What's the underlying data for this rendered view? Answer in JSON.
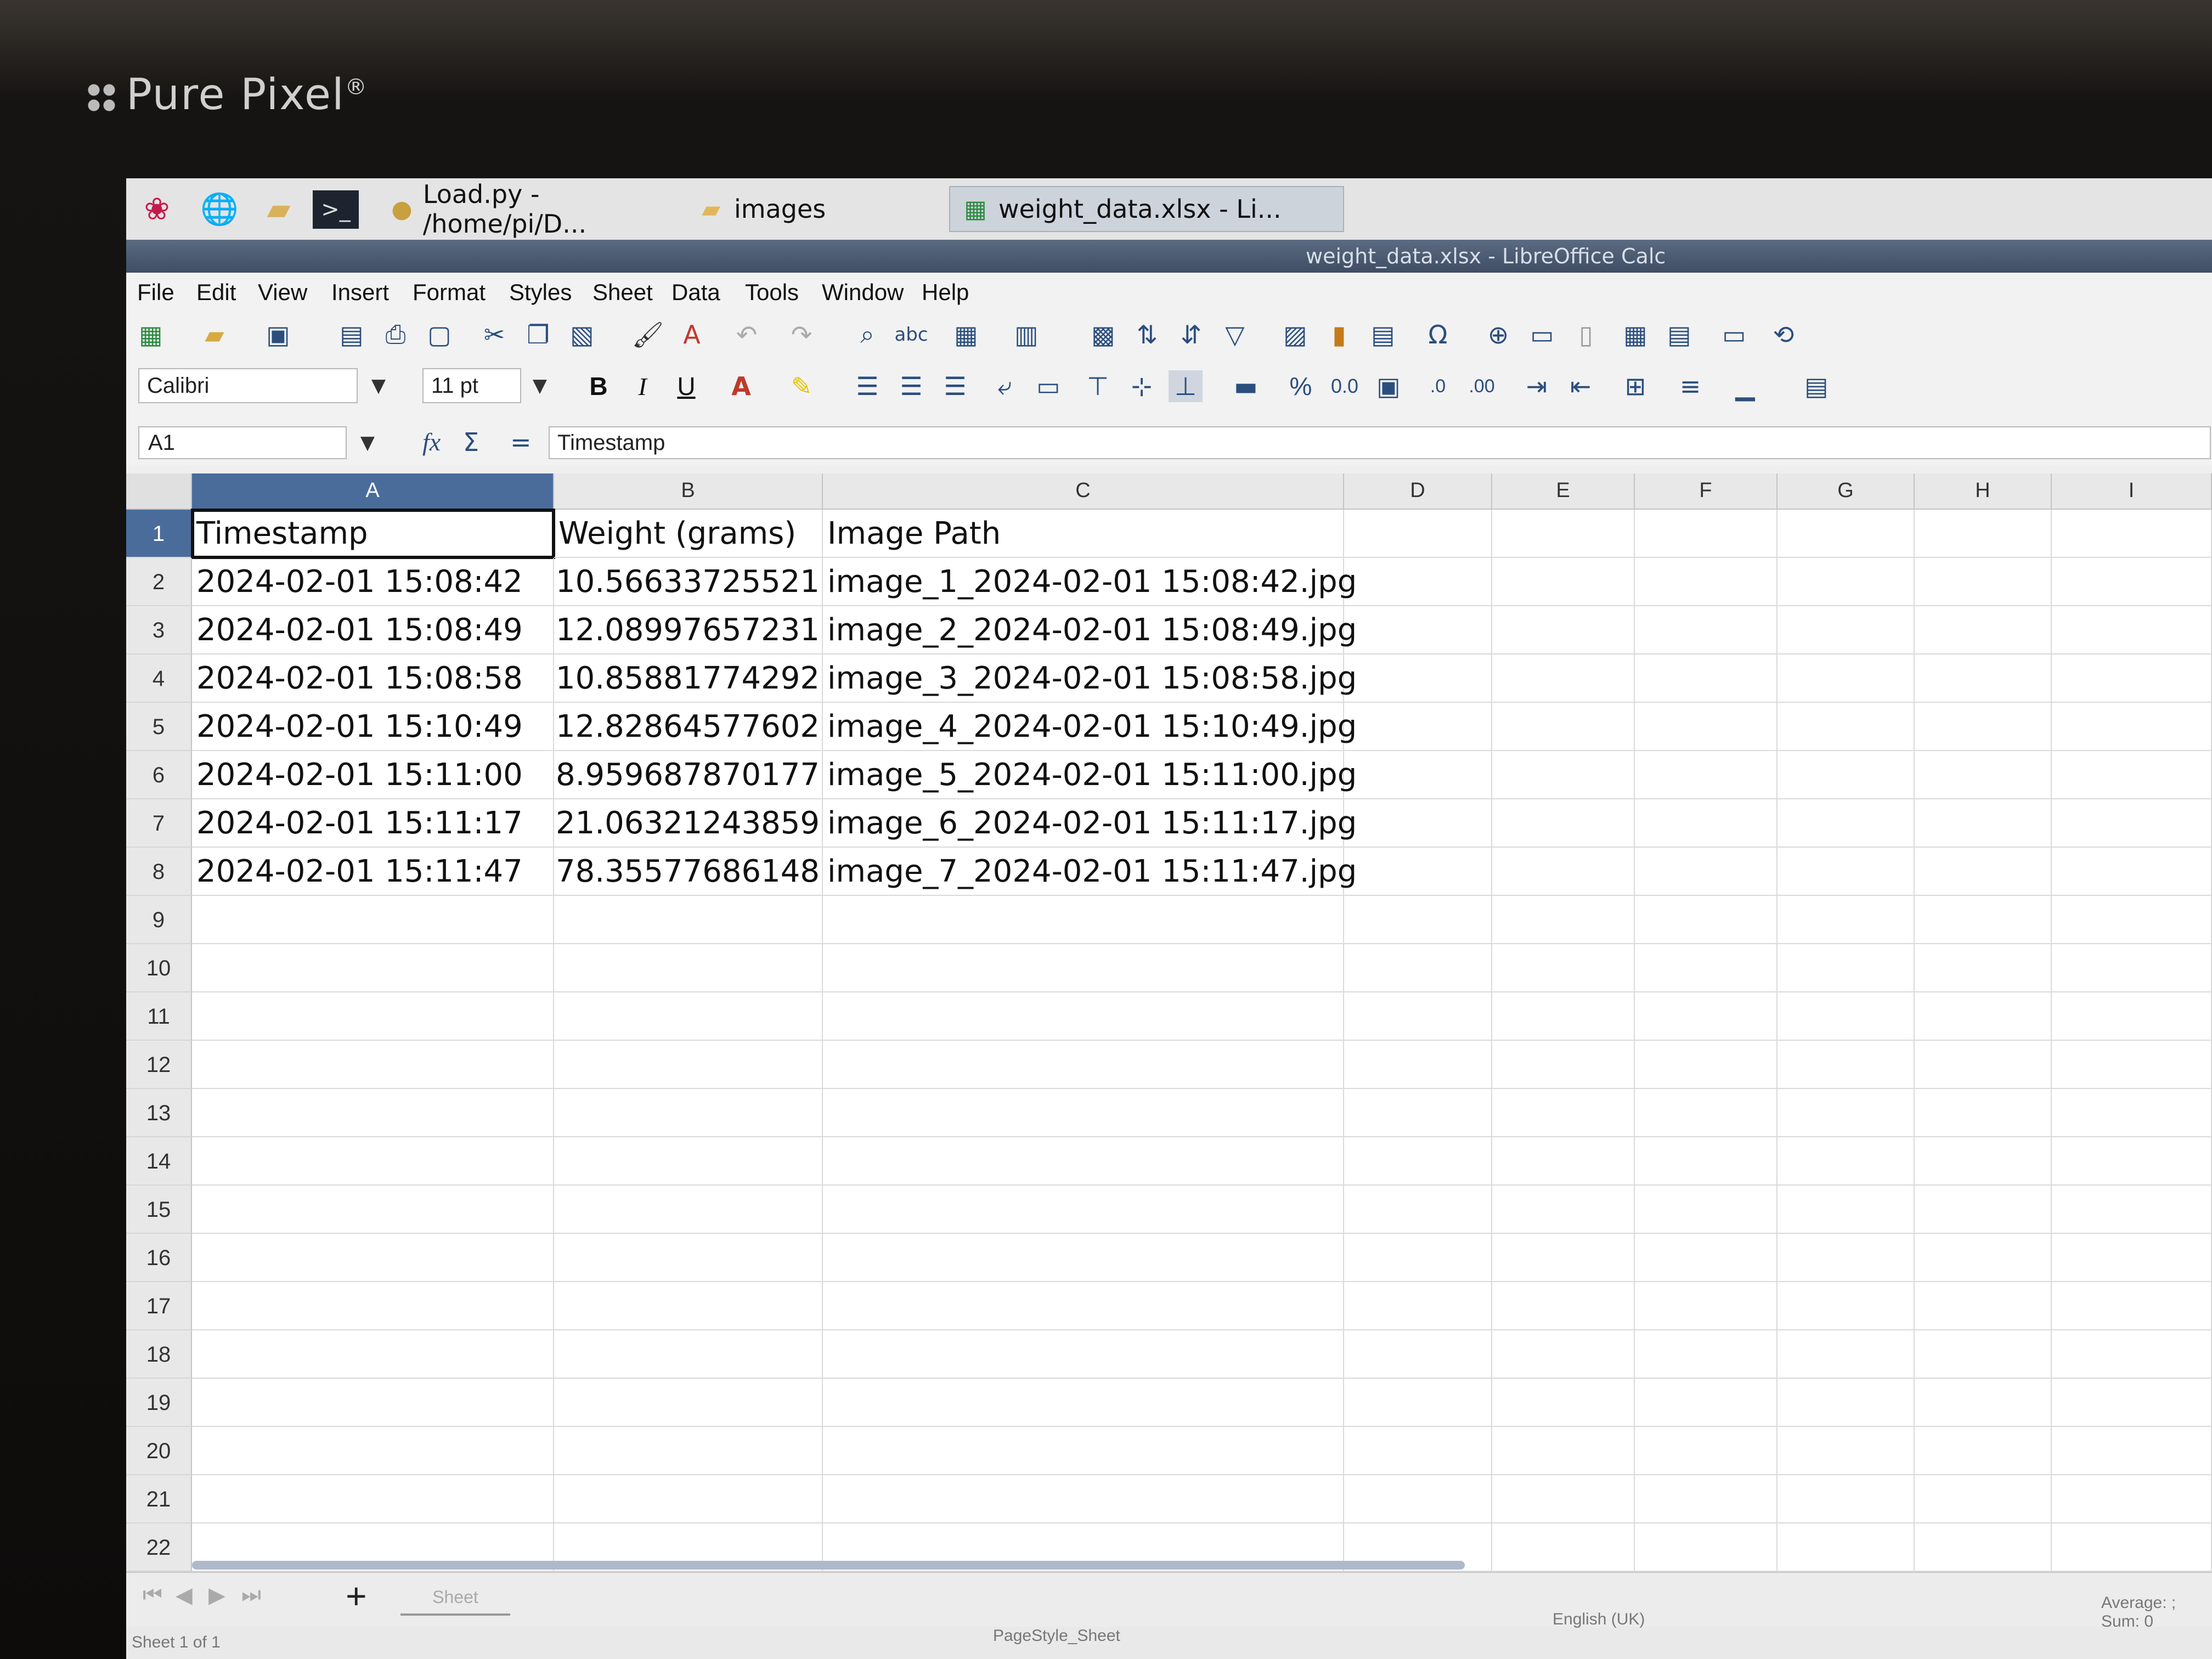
{
  "monitor": {
    "brand": "Pure Pixel",
    "registered_mark": "®"
  },
  "taskbar": {
    "tasks": [
      {
        "label": "Load.py - /home/pi/D..."
      },
      {
        "label": "images"
      },
      {
        "label": "weight_data.xlsx - Li..."
      }
    ]
  },
  "window": {
    "title": "weight_data.xlsx - LibreOffice Calc"
  },
  "menubar": {
    "items": [
      "File",
      "Edit",
      "View",
      "Insert",
      "Format",
      "Styles",
      "Sheet",
      "Data",
      "Tools",
      "Window",
      "Help"
    ]
  },
  "formatting": {
    "font_name": "Calibri",
    "font_size": "11 pt",
    "bold": "B",
    "italic": "I",
    "underline": "U",
    "percent": "%",
    "number": "0.0",
    "add_decimal": ".0",
    "remove_decimal": ".00"
  },
  "formula_bar": {
    "name_box": "A1",
    "content": "Timestamp",
    "fx": "fx",
    "sigma": "Σ",
    "equals": "="
  },
  "grid": {
    "columns": [
      "A",
      "B",
      "C",
      "D",
      "E",
      "F",
      "G",
      "H",
      "I"
    ],
    "selected_column": "A",
    "rows": [
      "1",
      "2",
      "3",
      "4",
      "5",
      "6",
      "7",
      "8",
      "9",
      "10",
      "11",
      "12",
      "13",
      "14",
      "15",
      "16",
      "17",
      "18",
      "19",
      "20",
      "21",
      "22"
    ],
    "headers": [
      "Timestamp",
      "Weight (grams)",
      "Image Path"
    ],
    "data": [
      [
        "2024-02-01 15:08:42",
        "10.56633725521",
        "image_1_2024-02-01 15:08:42.jpg"
      ],
      [
        "2024-02-01 15:08:49",
        "12.08997657231",
        "image_2_2024-02-01 15:08:49.jpg"
      ],
      [
        "2024-02-01 15:08:58",
        "10.85881774292",
        "image_3_2024-02-01 15:08:58.jpg"
      ],
      [
        "2024-02-01 15:10:49",
        "12.82864577602",
        "image_4_2024-02-01 15:10:49.jpg"
      ],
      [
        "2024-02-01 15:11:00",
        "8.959687870177",
        "image_5_2024-02-01 15:11:00.jpg"
      ],
      [
        "2024-02-01 15:11:17",
        "21.06321243859",
        "image_6_2024-02-01 15:11:17.jpg"
      ],
      [
        "2024-02-01 15:11:47",
        "78.35577686148",
        "image_7_2024-02-01 15:11:47.jpg"
      ]
    ]
  },
  "sheet_tabs": {
    "add": "+",
    "tab": "Sheet"
  },
  "statusbar": {
    "sheet_info": "Sheet 1 of 1",
    "page_style": "PageStyle_Sheet",
    "language": "English (UK)",
    "summary": "Average: ; Sum: 0"
  }
}
